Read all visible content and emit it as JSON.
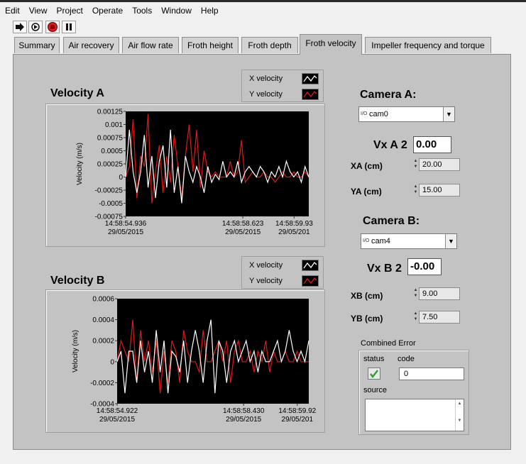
{
  "menu": [
    "Edit",
    "View",
    "Project",
    "Operate",
    "Tools",
    "Window",
    "Help"
  ],
  "toolbar": [
    "run-arrow-icon",
    "run-continuously-icon",
    "abort-stop-icon",
    "pause-icon"
  ],
  "tabs": [
    {
      "label": "Summary"
    },
    {
      "label": "Air recovery"
    },
    {
      "label": "Air flow rate"
    },
    {
      "label": "Froth height"
    },
    {
      "label": "Froth depth"
    },
    {
      "label": "Froth velocity",
      "active": true
    },
    {
      "label": "Impeller frequency and torque"
    }
  ],
  "colors": {
    "x_series": "#ffffff",
    "y_series": "#e01818",
    "plot_bg": "#000000",
    "panel_bg": "#c3c3c3"
  },
  "chart_data": [
    {
      "type": "line",
      "title": "Velocity A",
      "ylabel": "Velocity (m/s)",
      "xlabel": "",
      "ylim": [
        -0.00075,
        0.00125
      ],
      "yticks": [
        "0.00125",
        "0.001",
        "0.00075",
        "0.0005",
        "0.00025",
        "0",
        "-0.00025",
        "-0.0005",
        "-0.00075"
      ],
      "ytick_values": [
        0.00125,
        0.001,
        0.00075,
        0.0005,
        0.00025,
        0,
        -0.00025,
        -0.0005,
        -0.00075
      ],
      "xticks": [
        {
          "time": "14:58:54.936",
          "date": "29/05/2015"
        },
        {
          "time": "14:58:58.623",
          "date": "29/05/2015"
        },
        {
          "time": "14:58:59.93",
          "date": "29/05/201"
        }
      ],
      "xtick_pos": [
        0.0,
        0.64,
        0.92
      ],
      "grid": false,
      "legend": "top-right",
      "series": [
        {
          "name": "X velocity",
          "values": [
            0,
            0.0009,
            0.0001,
            -0.0003,
            0.0001,
            0.0008,
            -0.0002,
            0.0004,
            -0.0004,
            0.0003,
            0.0006,
            -0.0002,
            0.0009,
            -0.0003,
            0.0002,
            -0.0005,
            0.0004,
            0.0001,
            -0.0001,
            0.0002,
            0,
            -0.0003,
            0.0002,
            -0.0001,
            5e-05,
            -5e-05,
            0.0003,
            0,
            0.0001,
            0,
            0.0003,
            -0.0001,
            0.0001,
            0.0002,
            0.0001,
            0,
            0.0002,
            0.0001,
            -0.0001,
            0.0001,
            0,
            0.0002,
            0,
            0.0003,
            0.0001,
            0,
            0.0001,
            -0.0001,
            0.0002,
            0
          ]
        },
        {
          "name": "Y velocity",
          "values": [
            0,
            0.0002,
            0.0011,
            -0.0004,
            0.0004,
            0.0002,
            0.0012,
            -0.0005,
            0.0001,
            0.0006,
            -0.0003,
            0.0004,
            -0.0001,
            0.0008,
            0.0002,
            -0.0004,
            0.0004,
            0.001,
            0.0001,
            0.0009,
            -0.0002,
            0.0005,
            0.0001,
            0,
            0.0001,
            0,
            0,
            0,
            0.0003,
            0,
            0.0001,
            0.0007,
            -0.0001,
            0,
            0.0001,
            0,
            0,
            0.0001,
            0,
            0,
            -0.0001,
            0,
            0.0001,
            0,
            0,
            0.0001,
            0,
            0,
            0.0001,
            0
          ]
        }
      ]
    },
    {
      "type": "line",
      "title": "Velocity B",
      "ylabel": "Velocity (m/s)",
      "xlabel": "",
      "ylim": [
        -0.0004,
        0.0006
      ],
      "yticks": [
        "0.0006",
        "0.0004",
        "0.0002",
        "0",
        "-0.0002",
        "-0.0004"
      ],
      "ytick_values": [
        0.0006,
        0.0004,
        0.0002,
        0,
        -0.0002,
        -0.0004
      ],
      "xticks": [
        {
          "time": "14:58:54.922",
          "date": "29/05/2015"
        },
        {
          "time": "14:58:58.430",
          "date": "29/05/2015"
        },
        {
          "time": "14:58:59.92",
          "date": "29/05/201"
        }
      ],
      "xtick_pos": [
        0.0,
        0.66,
        0.94
      ],
      "grid": false,
      "legend": "top-right",
      "series": [
        {
          "name": "X velocity",
          "values": [
            0,
            0.0001,
            -0.0003,
            0.0001,
            0.0001,
            -0.0002,
            0.0002,
            -0.0001,
            0.0001,
            -0.0002,
            0.0003,
            -0.0001,
            0.0002,
            -0.0003,
            0.0001,
            5e-05,
            -0.0001,
            0.0002,
            -0.0002,
            0.0001,
            0.0003,
            0.0001,
            -0.0002,
            0.0002,
            0.0004,
            -0.0003,
            0.0002,
            0.0001,
            -0.0002,
            0.0001,
            0.0002,
            0,
            0.0001,
            0.0002,
            0,
            0.0001,
            -0.0001,
            0.0001,
            0,
            0,
            0.0001,
            0.0002,
            0,
            0.0001,
            0.0003,
            0.0001,
            0,
            0.0001,
            0,
            0.0002
          ]
        },
        {
          "name": "Y velocity",
          "values": [
            0,
            0.0002,
            0.0001,
            0,
            0.0004,
            -0.0002,
            0.0003,
            0,
            0.0002,
            -0.0001,
            0.0002,
            -0.0003,
            0.0001,
            -0.0002,
            0.0002,
            0.0001,
            -0.0002,
            0.0003,
            0.0001,
            0,
            0,
            -0.0001,
            0.0003,
            0,
            0,
            0.0001,
            0.0002,
            0,
            0.0002,
            -0.0002,
            0.0001,
            0.0002,
            0,
            0,
            0.0001,
            -0.0001,
            0.0001,
            0,
            0.0002,
            -0.0001,
            0.0001,
            0,
            0,
            0.0001,
            0,
            0,
            0.0001,
            0,
            0,
            0
          ]
        }
      ]
    }
  ],
  "legend": {
    "x_label": "X velocity",
    "y_label": "Y velocity"
  },
  "camera_a": {
    "heading": "Camera A:",
    "prefix": "I/O",
    "selected": "cam0",
    "vx_label": "Vx A 2",
    "vx_value": "0.00",
    "x_label": "XA (cm)",
    "x_value": "20.00",
    "y_label": "YA (cm)",
    "y_value": "15.00"
  },
  "camera_b": {
    "heading": "Camera B:",
    "prefix": "I/O",
    "selected": "cam4",
    "vx_label": "Vx B 2",
    "vx_value": "-0.00",
    "x_label": "XB (cm)",
    "x_value": "9.00",
    "y_label": "YB (cm)",
    "y_value": "7.50"
  },
  "error": {
    "title": "Combined Error",
    "status_label": "status",
    "code_label": "code",
    "code_value": "0",
    "source_label": "source",
    "status_ok": true
  }
}
